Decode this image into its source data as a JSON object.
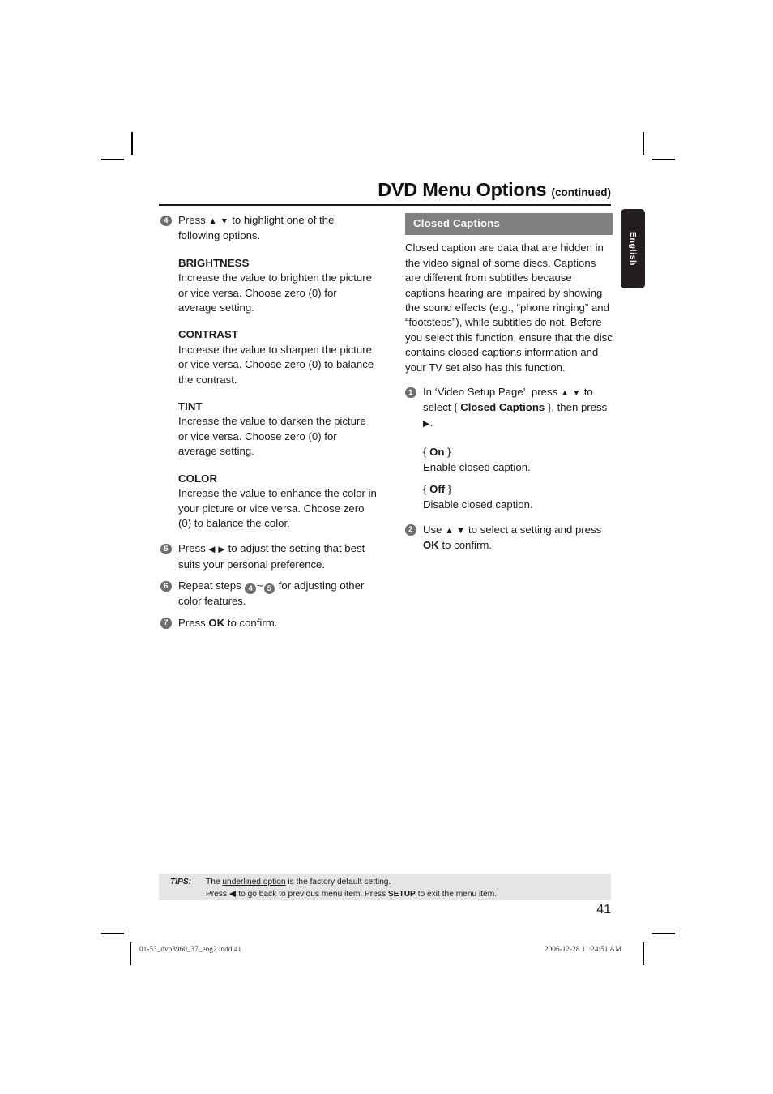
{
  "header": {
    "title": "DVD Menu Options",
    "continued": "(continued)"
  },
  "language_tab": {
    "label": "English"
  },
  "left_column": {
    "step4": {
      "number": "4",
      "text_before": "Press ",
      "arrows": "▲ ▼",
      "text_after": " to highlight one of the following options."
    },
    "options": [
      {
        "heading": "BRIGHTNESS",
        "body": "Increase the value to brighten the picture or vice versa. Choose zero (0) for average setting."
      },
      {
        "heading": "CONTRAST",
        "body": "Increase the value to sharpen the picture or vice versa.  Choose zero (0) to balance the contrast."
      },
      {
        "heading": "TINT",
        "body": "Increase the value to darken the picture or vice versa.  Choose zero (0) for average setting."
      },
      {
        "heading": "COLOR",
        "body": "Increase the value to enhance the color in your picture or vice versa. Choose zero (0) to balance the color."
      }
    ],
    "step5": {
      "number": "5",
      "text_before": "Press ",
      "arrows": "◀ ▶",
      "text_after": " to adjust the setting that best suits your personal preference."
    },
    "step6": {
      "number": "6",
      "text_before": "Repeat steps ",
      "ref_a": "4",
      "tilde": "~",
      "ref_b": "5",
      "text_after": " for adjusting other color features."
    },
    "step7": {
      "number": "7",
      "text_before": "Press ",
      "bold": "OK",
      "text_after": " to confirm."
    }
  },
  "right_column": {
    "section_title": "Closed Captions",
    "section_body": "Closed caption are data that are hidden in the video signal of some discs. Captions are different from subtitles because captions hearing are impaired by showing the sound effects (e.g., “phone ringing” and “footsteps”), while subtitles do not. Before you select this function, ensure that the disc contains closed captions information and your TV set also has this function.",
    "step1": {
      "number": "1",
      "text_a": "In ‘Video Setup Page’, press ",
      "arrows": "▲ ▼",
      "text_b": " to select { ",
      "bold": "Closed Captions",
      "text_c": " }, then press ",
      "arrow_right": "▶",
      "text_d": "."
    },
    "settings": [
      {
        "label_open": "{ ",
        "label": "On",
        "label_close": " }",
        "underlined": false,
        "description": "Enable closed caption."
      },
      {
        "label_open": "{ ",
        "label": "Off",
        "label_close": " }",
        "underlined": true,
        "description": "Disable closed caption."
      }
    ],
    "step2": {
      "number": "2",
      "text_before": "Use ",
      "arrows": "▲ ▼",
      "text_mid": " to select a setting and press ",
      "bold": "OK",
      "text_after": " to confirm."
    }
  },
  "tips": {
    "label": "TIPS:",
    "line1_a": "The ",
    "line1_underlined": "underlined option",
    "line1_b": " is the factory default setting.",
    "line2_a": "Press ",
    "line2_arrow": "◀",
    "line2_b": " to go back to previous menu item. Press ",
    "line2_bold": "SETUP",
    "line2_c": " to exit the menu item."
  },
  "page_number": "41",
  "print_footer": {
    "left": "01-53_dvp3960_37_eng2.indd   41",
    "right": "2006-12-28   11:24:51 AM"
  }
}
